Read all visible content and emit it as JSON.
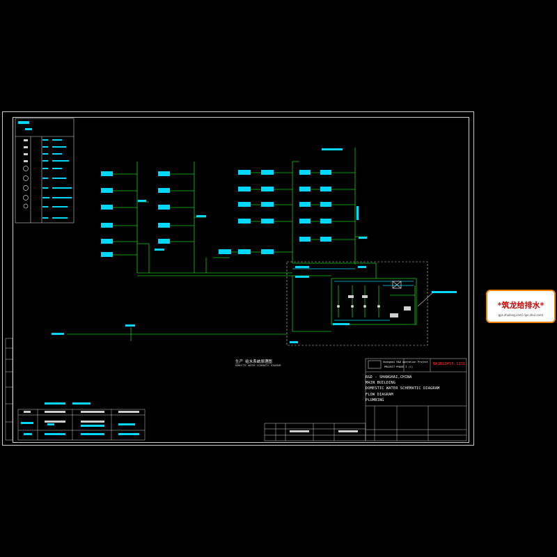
{
  "stamp": {
    "brand": "*筑龙给排水*",
    "url": "gps.zhulong.com/ (ips.zhul.com)"
  },
  "title_block": {
    "project_line1": "Shanghai R&D Operation Project",
    "project_line2": "PROJECT PHASE I (1)",
    "drawing_number": "NA1B1DP55-1131",
    "location": "R&D - SHANGHAI,CHINA",
    "building": "MAIN BUILDING",
    "drawing_title": "DOMESTIC WATER SCHEMATIC DIAGRAM",
    "drawing_type": "FLOW DIAGRAM",
    "discipline": "PLUMBING"
  },
  "diagram": {
    "main_label": "生产 给水系统原理图",
    "main_sub_label": "DOMESTIC WATER SCHEMATIC DIAGRAM"
  },
  "colors": {
    "background": "#000000",
    "frame": "#cfcfcf",
    "pipe_green": "#18c818",
    "pipe_cyan": "#00d8ff",
    "label_white": "#ffffff",
    "drawing_number_red": "#ff3030",
    "stamp_border": "#f08000"
  }
}
